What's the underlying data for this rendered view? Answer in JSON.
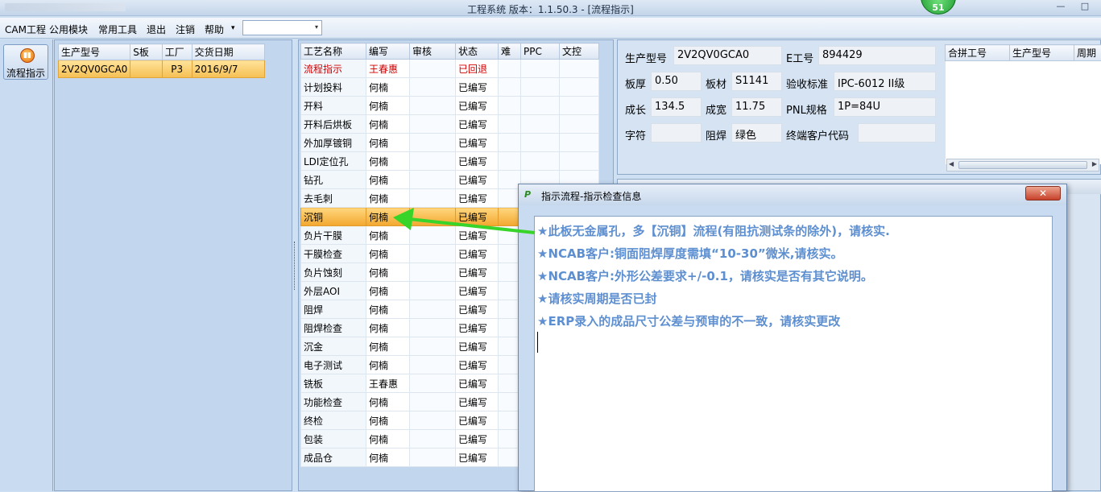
{
  "window": {
    "title": "工程系统   版本：1.1.50.3 - [流程指示]",
    "badge": "51",
    "controls": [
      "—",
      "□"
    ]
  },
  "menu": {
    "items": [
      "CAM工程",
      "公用模块",
      "常用工具",
      "退出",
      "注销",
      "帮助"
    ],
    "help_arrow": "▾",
    "combo_value": "",
    "combo_arrow": "▾"
  },
  "sidebar": {
    "flow_button_label": "流程指示",
    "flow_icon": "play-icon"
  },
  "product_list": {
    "columns": [
      "生产型号",
      "S板",
      "工厂",
      "交货日期"
    ],
    "rows": [
      {
        "model": "2V2QV0GCA0",
        "s_board": "",
        "factory": "P3",
        "delivery_date": "2016/9/7"
      }
    ]
  },
  "process_table": {
    "columns": [
      "工艺名称",
      "编写",
      "审核",
      "状态",
      "难",
      "PPC",
      "文控"
    ],
    "rows": [
      {
        "name": "流程指示",
        "writer": "王春惠",
        "status": "已回退",
        "style": "red"
      },
      {
        "name": "计划投料",
        "writer": "何楠",
        "status": "已编写"
      },
      {
        "name": "开料",
        "writer": "何楠",
        "status": "已编写"
      },
      {
        "name": "开料后烘板",
        "writer": "何楠",
        "status": "已编写"
      },
      {
        "name": "外加厚镀铜",
        "writer": "何楠",
        "status": "已编写"
      },
      {
        "name": "LDI定位孔",
        "writer": "何楠",
        "status": "已编写"
      },
      {
        "name": "钻孔",
        "writer": "何楠",
        "status": "已编写"
      },
      {
        "name": "去毛刺",
        "writer": "何楠",
        "status": "已编写"
      },
      {
        "name": "沉铜",
        "writer": "何楠",
        "status": "已编写",
        "style": "selected"
      },
      {
        "name": "负片干膜",
        "writer": "何楠",
        "status": "已编写"
      },
      {
        "name": "干膜检查",
        "writer": "何楠",
        "status": "已编写"
      },
      {
        "name": "负片蚀刻",
        "writer": "何楠",
        "status": "已编写"
      },
      {
        "name": "外层AOI",
        "writer": "何楠",
        "status": "已编写"
      },
      {
        "name": "阻焊",
        "writer": "何楠",
        "status": "已编写"
      },
      {
        "name": "阻焊检查",
        "writer": "何楠",
        "status": "已编写"
      },
      {
        "name": "沉金",
        "writer": "何楠",
        "status": "已编写"
      },
      {
        "name": "电子测试",
        "writer": "何楠",
        "status": "已编写"
      },
      {
        "name": "铣板",
        "writer": "王春惠",
        "status": "已编写"
      },
      {
        "name": "功能检查",
        "writer": "何楠",
        "status": "已编写"
      },
      {
        "name": "终检",
        "writer": "何楠",
        "status": "已编写"
      },
      {
        "name": "包装",
        "writer": "何楠",
        "status": "已编写"
      },
      {
        "name": "成品仓",
        "writer": "何楠",
        "status": "已编写"
      }
    ]
  },
  "info": {
    "model_label": "生产型号",
    "model_value": "2V2QV0GCA0",
    "eno_label": "E工号",
    "eno_value": "894429",
    "thickness_label": "板厚",
    "thickness_value": "0.50",
    "material_label": "板材",
    "material_value": "S1141",
    "standard_label": "验收标准",
    "standard_value": "IPC-6012 II级",
    "length_label": "成长",
    "length_value": "134.5",
    "width_label": "成宽",
    "width_value": "11.75",
    "pnl_label": "PNL规格",
    "pnl_value": "1P=84U",
    "char_label": "字符",
    "char_value": "",
    "mask_label": "阻焊",
    "mask_value": "绿色",
    "customer_label": "终端客户代码",
    "customer_value": ""
  },
  "merge_table": {
    "columns": [
      "合拼工号",
      "生产型号",
      "周期"
    ]
  },
  "dialog": {
    "title": "指示流程-指示检查信息",
    "close_label": "✕",
    "notes": [
      "★此板无金属孔，多【沉铜】流程(有阻抗测试条的除外)，请核实.",
      "★NCAB客户:铜面阻焊厚度需填“10-30”微米,请核实。",
      "★NCAB客户:外形公差要求+/-0.1，请核实是否有其它说明。",
      "★请核实周期是否已封",
      "★ERP录入的成品尺寸公差与预审的不一致，请核实更改"
    ]
  },
  "colors": {
    "selected_row": "#f2a72e",
    "returned_status": "#d00000",
    "note_text": "#5e8fd0",
    "annotation_arrow": "#38d42a"
  }
}
